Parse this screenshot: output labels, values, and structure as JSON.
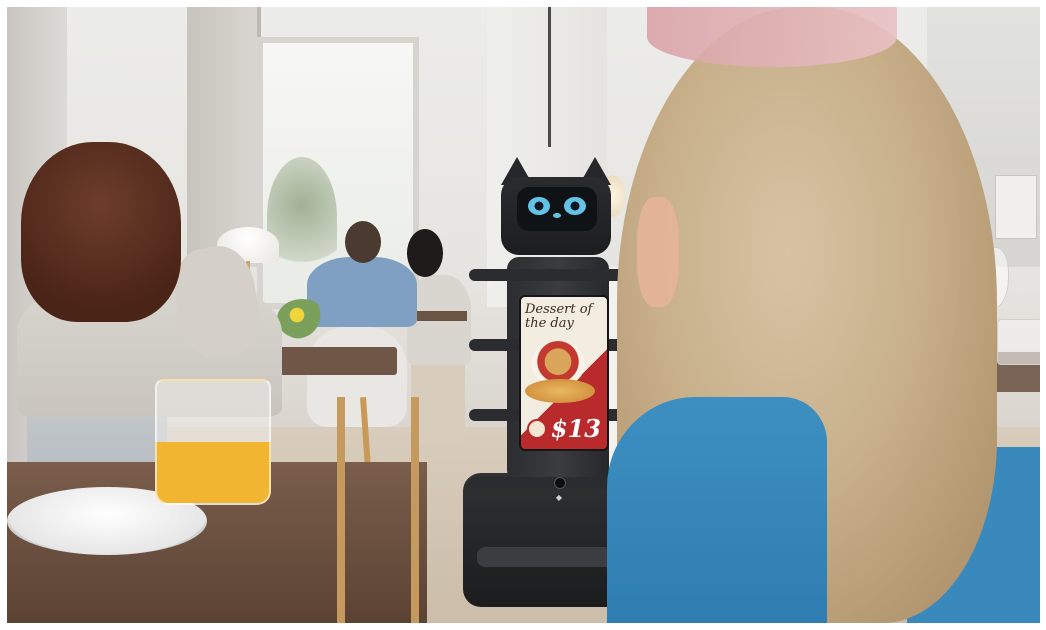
{
  "scene": {
    "description_tag": "restaurant-with-serving-robot",
    "robot_screen": {
      "headline": "Dessert of the day",
      "price": "$13"
    },
    "colors": {
      "robot_body": "#2b2d30",
      "screen_accent": "#b82a2b",
      "juice": "#f2b531",
      "shirt": "#3d8fc2"
    }
  }
}
